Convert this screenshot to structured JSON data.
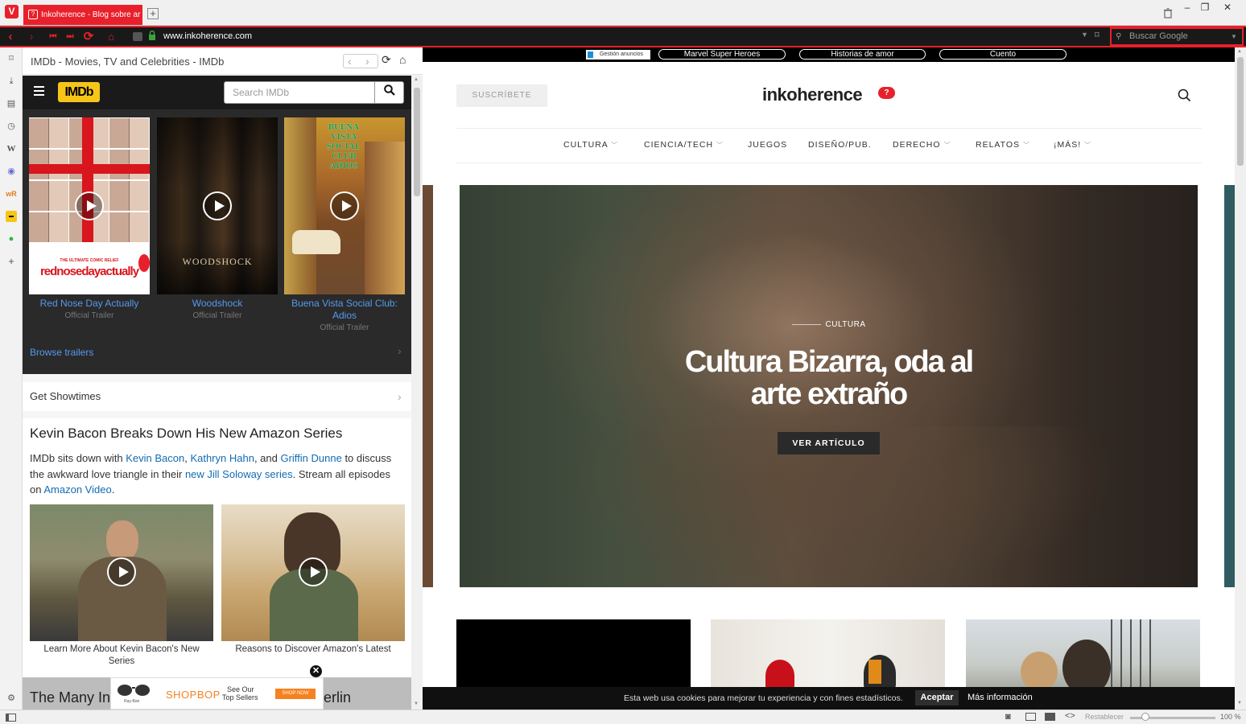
{
  "browser": {
    "tab_title": "Inkoherence - Blog sobre ar",
    "url": "www.inkoherence.com",
    "search_placeholder": "Buscar Google",
    "zoom": "100 %",
    "zoom_reset": "Restablecer",
    "accent": "#e8202b"
  },
  "panel": {
    "title": "IMDb - Movies, TV and Celebrities - IMDb",
    "logo": "IMDb",
    "search_placeholder": "Search IMDb",
    "trailers": [
      {
        "title": "Red Nose Day Actually",
        "subtitle": "Official Trailer",
        "poster_text": "rednosedayactually",
        "poster_tag": "THE ULTIMATE COMIC RELIEF"
      },
      {
        "title": "Woodshock",
        "subtitle": "Official Trailer",
        "poster_text": "WOODSHOCK"
      },
      {
        "title": "Buena Vista Social Club: Adios",
        "subtitle": "Official Trailer",
        "poster_text": "BUENA VISTA SOCIAL CLUB ADIOS"
      }
    ],
    "browse_label": "Browse trailers",
    "showtimes_label": "Get Showtimes",
    "news": {
      "title": "Kevin Bacon Breaks Down His New Amazon Series",
      "t1": "IMDb sits down with ",
      "l1": "Kevin Bacon",
      "t2": ", ",
      "l2": "Kathryn Hahn",
      "t3": ", and ",
      "l3": "Griffin Dunne",
      "t4": " to discuss the awkward love triangle in their ",
      "l4": "new Jill Soloway series",
      "t5": ". Stream all episodes on ",
      "l5": "Amazon Video",
      "t6": ".",
      "captions": [
        "Learn More About Kevin Bacon's New Series",
        "Reasons to Discover Amazon's Latest"
      ]
    },
    "bottom_left": "The Many In",
    "bottom_right": "erlin",
    "ad": {
      "brand": "SHOPBOP",
      "text1": "See Our",
      "text2": "Top Sellers",
      "cta": "SHOP NOW",
      "logo": "Ray-Ban"
    }
  },
  "site": {
    "bookmarks": [
      "Gestión anuncios",
      "Marvel Super Heroes",
      "Historias de amor",
      "Cuento"
    ],
    "subscribe": "SUSCRÍBETE",
    "logo": "inkoherence",
    "logo_mark": "?",
    "nav": [
      "CULTURA",
      "CIENCIA/TECH",
      "JUEGOS",
      "DISEÑO/PUB.",
      "DERECHO",
      "RELATOS",
      "¡MÁS!"
    ],
    "hero": {
      "category": "CULTURA",
      "title_line1": "Cultura Bizarra, oda al",
      "title_line2": "arte extraño",
      "button": "VER ARTÍCULO"
    },
    "cookie": {
      "text": "Esta web usa cookies para mejorar tu experiencia y con fines estadísticos.",
      "accept": "Aceptar",
      "more": "Más información"
    }
  }
}
